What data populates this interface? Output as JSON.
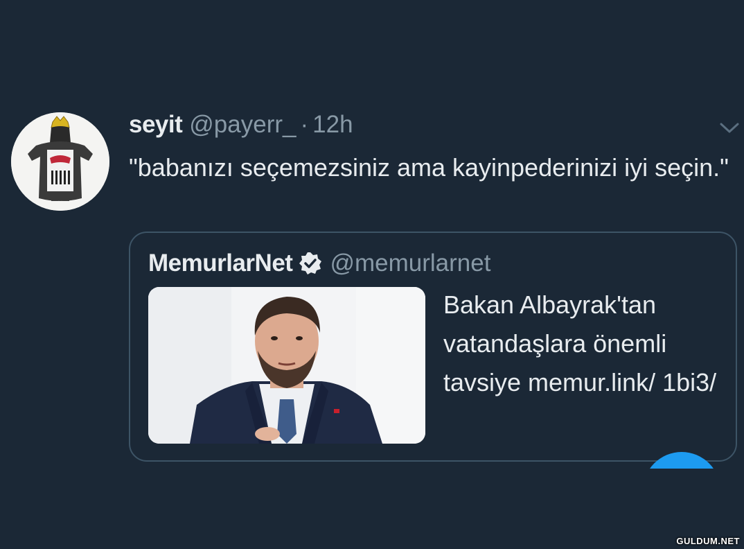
{
  "tweet": {
    "name": "seyit",
    "handle": "@payerr_",
    "separator": "·",
    "time": "12h",
    "text": "\"babanızı seçemezsiniz ama kayinpederinizi iyi seçin.\"",
    "menu_icon": "chevron-down-icon"
  },
  "quoted_tweet": {
    "name": "MemurlarNet",
    "verified_icon": "verified-badge-icon",
    "handle": "@memurlarnet",
    "text": "Bakan Albayrak'tan vatandaşlara önemli tavsiye memur.link/ 1bi3/"
  },
  "compose_button": {
    "icon": "compose-icon",
    "color": "#1d9bf0"
  },
  "watermark": "GULDUM.NET",
  "colors": {
    "background": "#1b2836",
    "text_primary": "#e8ecef",
    "text_secondary": "#8899a6",
    "card_border": "#3d5466",
    "accent": "#1d9bf0"
  }
}
